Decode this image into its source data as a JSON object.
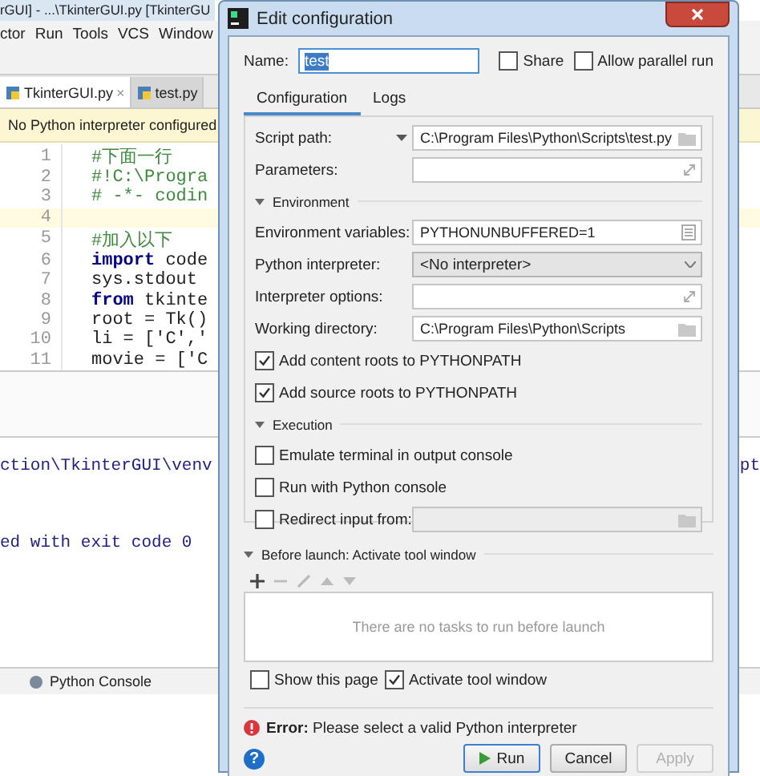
{
  "ide": {
    "title": "rGUI] - ...\\TkinterGUI.py [TkinterGU",
    "menu": [
      "ctor",
      "Run",
      "Tools",
      "VCS",
      "Window"
    ],
    "tabs": [
      {
        "label": "TkinterGUI.py",
        "selected": true,
        "close": "×"
      },
      {
        "label": "test.py",
        "selected": false
      }
    ],
    "notice": "No Python interpreter configured",
    "code_lines": [
      {
        "number": "1",
        "text": "#下面一行",
        "kind": "comment",
        "current": false
      },
      {
        "number": "2",
        "text": "#!C:\\Progra",
        "kind": "comment",
        "current": false
      },
      {
        "number": "3",
        "text": "# -*- codin",
        "kind": "comment",
        "current": false
      },
      {
        "number": "4",
        "current": true
      },
      {
        "number": "5",
        "text": "#加入以下",
        "kind": "comment",
        "current": false
      },
      {
        "number": "6",
        "text": "**import** code",
        "kind": "code",
        "current": false
      },
      {
        "number": "7",
        "text": "sys.stdout",
        "kind": "code",
        "current": false
      },
      {
        "number": "8",
        "text": "**from** tkinte",
        "kind": "code",
        "current": false
      },
      {
        "number": "9",
        "text": "root = Tk()",
        "kind": "code",
        "current": false
      },
      {
        "number": "10",
        "text": "li = ['C','",
        "kind": "code",
        "current": false
      },
      {
        "number": "11",
        "text": "movie = ['C",
        "kind": "code",
        "current": false
      }
    ],
    "console_lines": [
      {
        "left": "ction\\TkinterGUI\\venv",
        "right": "pt"
      },
      {
        "left": "ed with exit code 0"
      }
    ],
    "bottom_tool": "Python Console"
  },
  "dialog": {
    "title": "Edit configuration",
    "name_label": "Name:",
    "name_value": "test",
    "share": {
      "label": "Share",
      "checked": false
    },
    "allow_parallel": {
      "label": "Allow parallel run",
      "checked": false
    },
    "tabs": [
      {
        "label": "Configuration",
        "selected": true
      },
      {
        "label": "Logs",
        "selected": false
      }
    ],
    "rows": [
      {
        "kind": "path",
        "label": "Script path:",
        "value": "C:\\Program Files\\Python\\Scripts\\test.py",
        "menu": true
      },
      {
        "kind": "text",
        "label": "Parameters:"
      },
      {
        "kind": "section",
        "label": "Environment"
      },
      {
        "kind": "env",
        "label": "Environment variables:",
        "value": "PYTHONUNBUFFERED=1"
      },
      {
        "kind": "dropdown",
        "label": "Python interpreter:",
        "value": "<No interpreter>"
      },
      {
        "kind": "text",
        "label": "Interpreter options:"
      },
      {
        "kind": "path",
        "label": "Working directory:",
        "value": "C:\\Program Files\\Python\\Scripts"
      },
      {
        "kind": "checkbox",
        "label": "Add content roots to PYTHONPATH",
        "checked": true
      },
      {
        "kind": "checkbox",
        "label": "Add source roots to PYTHONPATH",
        "checked": true
      },
      {
        "kind": "section",
        "label": "Execution"
      },
      {
        "kind": "checkbox",
        "label": "Emulate terminal in output console",
        "checked": false
      },
      {
        "kind": "checkbox",
        "label": "Run with Python console",
        "checked": false
      },
      {
        "kind": "checkbox_path",
        "label": "Redirect input from:",
        "checked": false,
        "disabled": true
      }
    ],
    "before_launch": "Before launch: Activate tool window",
    "empty_tasks": "There are no tasks to run before launch",
    "show_page": {
      "label": "Show this page",
      "checked": false
    },
    "activate": {
      "label": "Activate tool window",
      "checked": true
    },
    "error": "**Error:** Please select a valid Python interpreter",
    "help": "?",
    "buttons": [
      {
        "label": "Run",
        "kind": "primary"
      },
      {
        "label": "Cancel",
        "kind": "normal"
      },
      {
        "label": "Apply",
        "kind": "disabled"
      }
    ]
  }
}
